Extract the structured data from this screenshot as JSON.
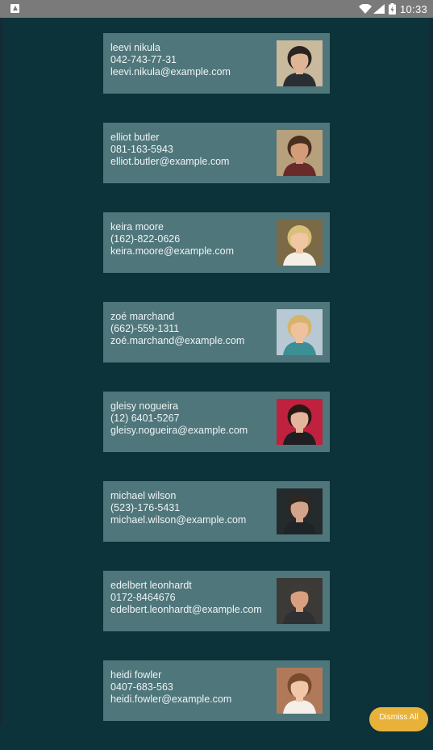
{
  "status_bar": {
    "time": "10:33",
    "icons": [
      "notification-icon",
      "wifi-icon",
      "signal-icon",
      "battery-icon"
    ]
  },
  "contacts": [
    {
      "name": "leevi nikula",
      "phone": "042-743-77-31",
      "email": "leevi.nikula@example.com",
      "bg": "#c9b99d",
      "skin": "#e0b595",
      "hair": "#2a2320",
      "shirt": "#2b2f33"
    },
    {
      "name": "elliot butler",
      "phone": "081-163-5943",
      "email": "elliot.butler@example.com",
      "bg": "#b7a07c",
      "skin": "#d59c7a",
      "hair": "#4a2e1f",
      "shirt": "#6b2a2a"
    },
    {
      "name": "keira moore",
      "phone": "(162)-822-0626",
      "email": "keira.moore@example.com",
      "bg": "#7b6a45",
      "skin": "#f0c6a3",
      "hair": "#d9c07a",
      "shirt": "#f3efe6"
    },
    {
      "name": "zoé marchand",
      "phone": "(662)-559-1311",
      "email": "zoé.marchand@example.com",
      "bg": "#b9c9d3",
      "skin": "#efc29e",
      "hair": "#d6b46d",
      "shirt": "#3c8f94"
    },
    {
      "name": "gleisy nogueira",
      "phone": "(12) 6401-5267",
      "email": "gleisy.nogueira@example.com",
      "bg": "#c0213f",
      "skin": "#e5b59b",
      "hair": "#2a1814",
      "shirt": "#1f1e22"
    },
    {
      "name": "michael wilson",
      "phone": "(523)-176-5431",
      "email": "michael.wilson@example.com",
      "bg": "#252a2c",
      "skin": "#d2a48a",
      "hair": "#2f2722",
      "shirt": "#1e2427"
    },
    {
      "name": "edelbert leonhardt",
      "phone": "0172-8464676",
      "email": "edelbert.leonhardt@example.com",
      "bg": "#3c3a36",
      "skin": "#d8a07e",
      "hair": "#3f3a35",
      "shirt": "#2d3134"
    },
    {
      "name": "heidi fowler",
      "phone": "0407-683-563",
      "email": "heidi.fowler@example.com",
      "bg": "#b07a5a",
      "skin": "#f1c7a8",
      "hair": "#7a4b2c",
      "shirt": "#f4efe9"
    }
  ],
  "dismiss_label": "Dismiss All"
}
